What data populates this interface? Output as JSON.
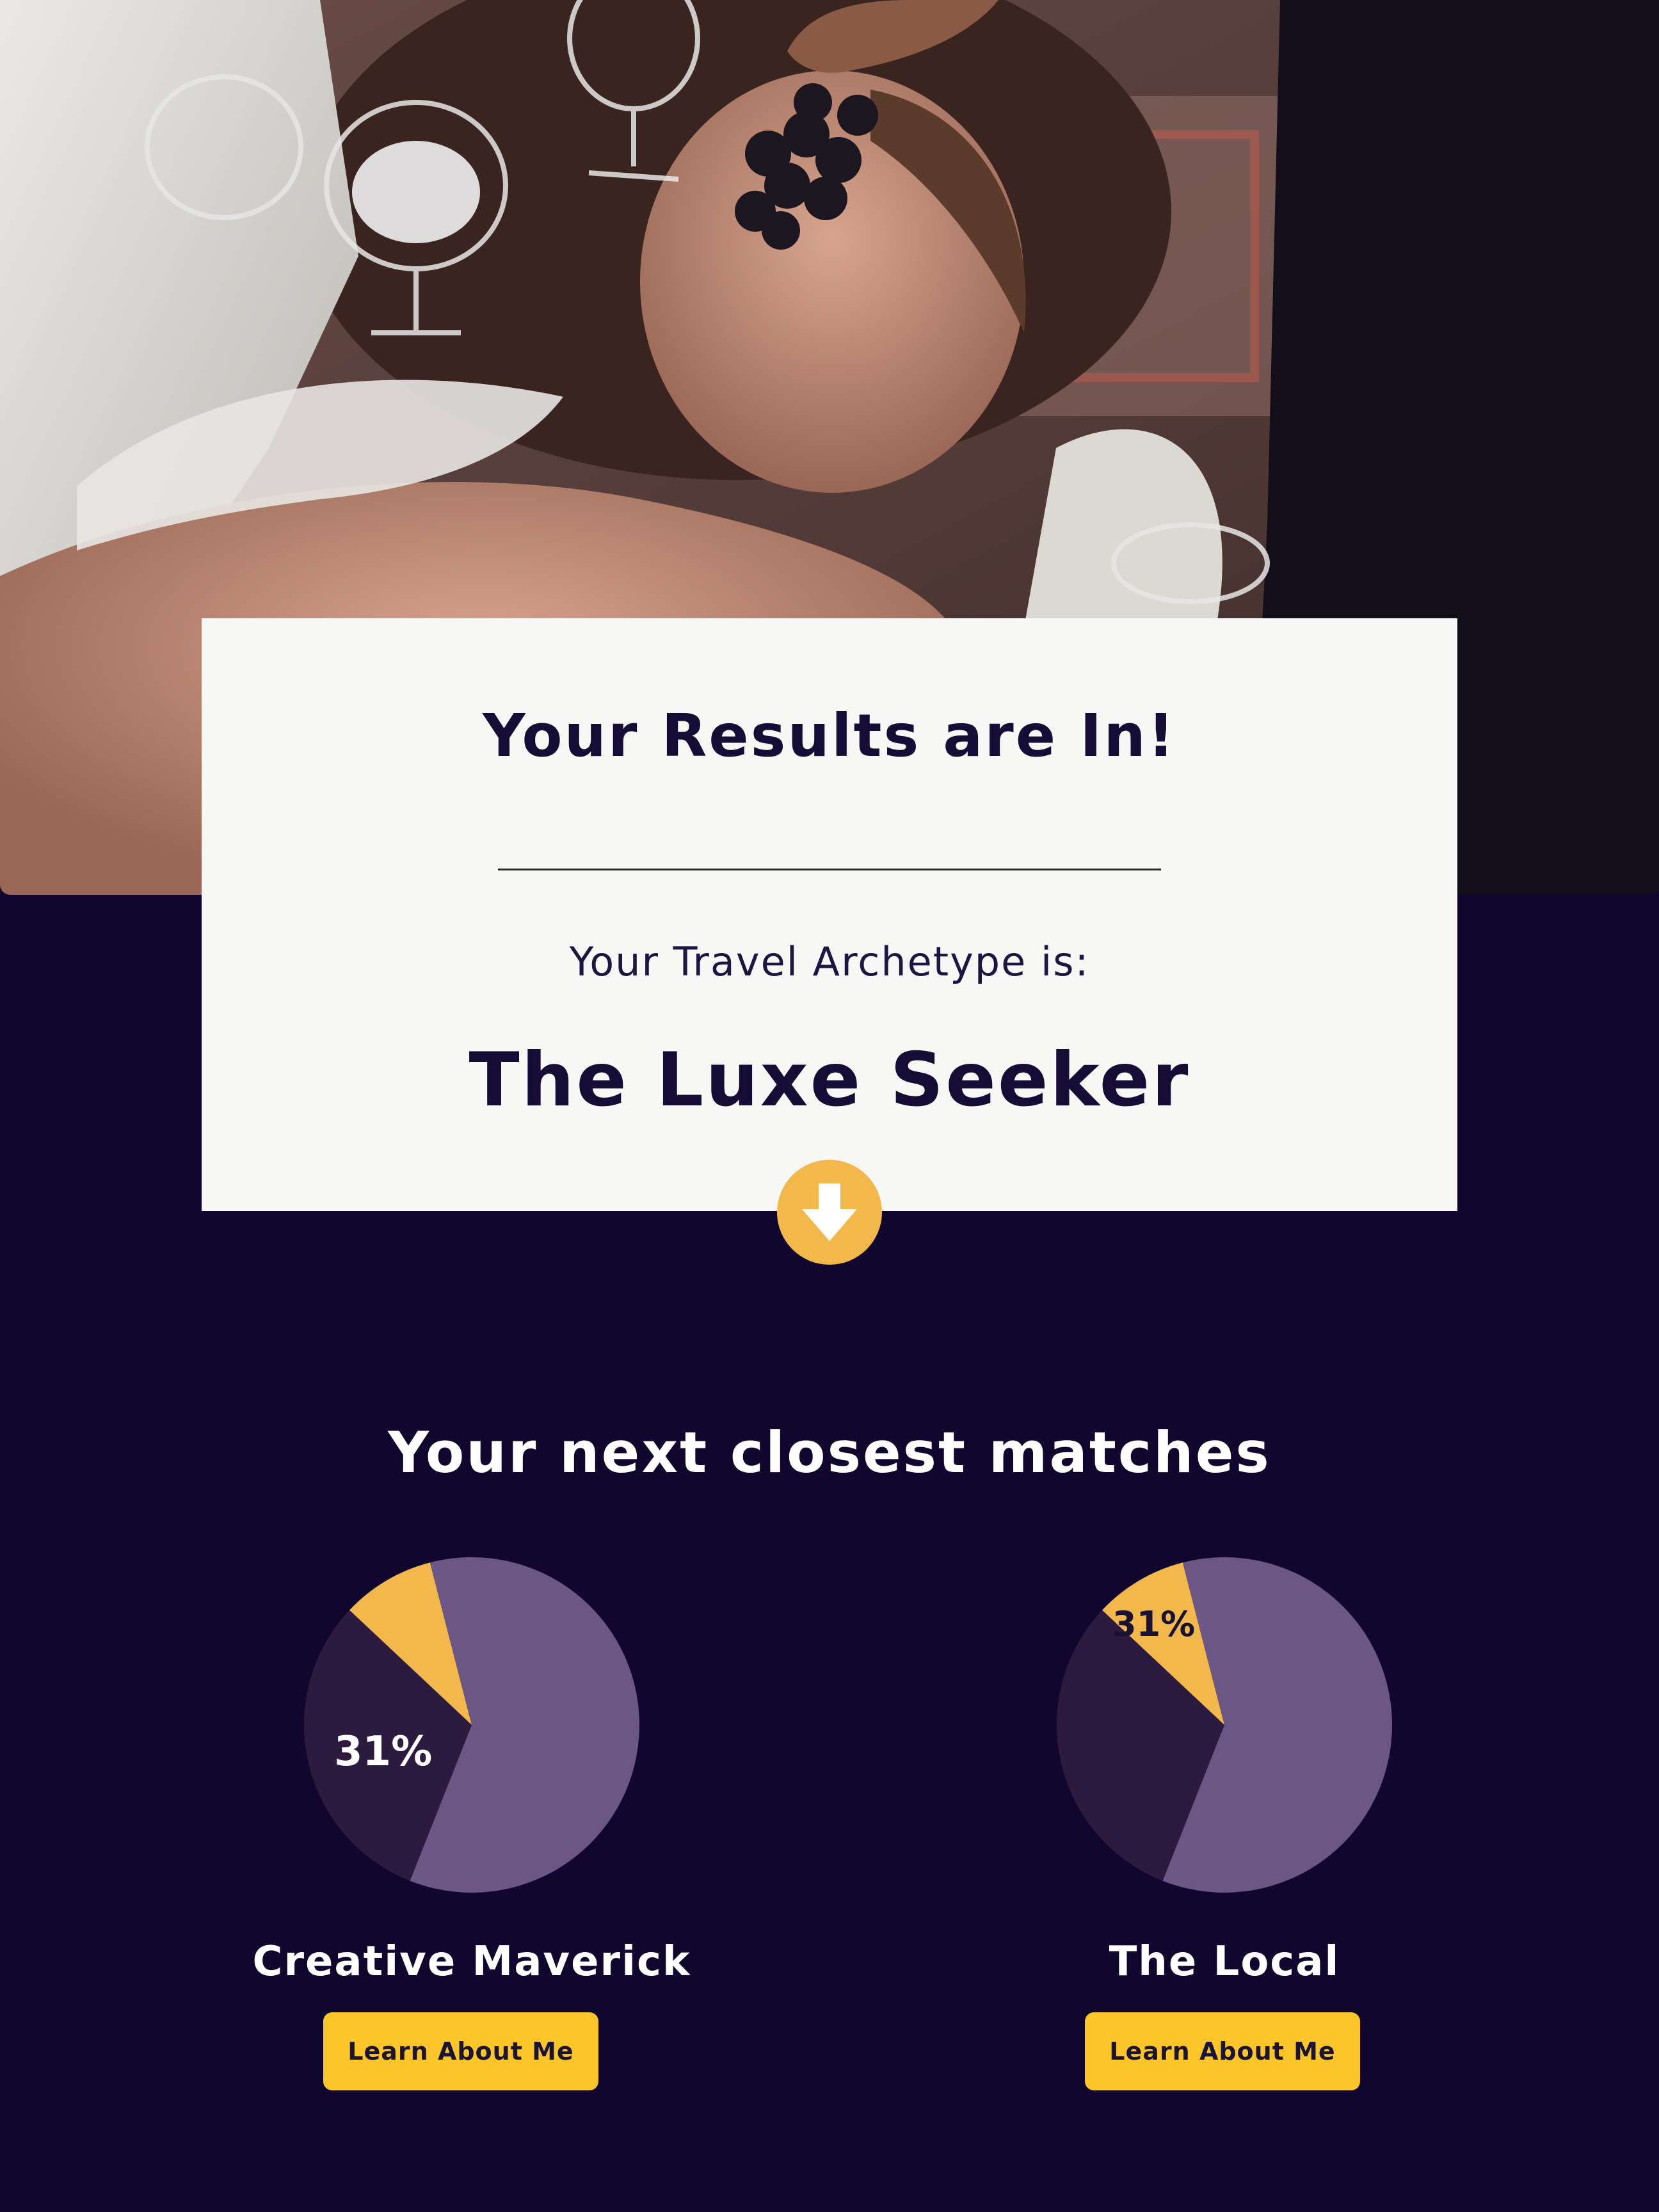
{
  "hero": {
    "image": "portrait-photo-grapes"
  },
  "result": {
    "title": "Your Results are In!",
    "archetype_label": "Your Travel Archetype is:",
    "archetype_name": "The Luxe Seeker",
    "scroll_icon": "arrow-down-icon"
  },
  "matches": {
    "title": "Your next closest matches",
    "items": [
      {
        "name": "Creative Maverick",
        "percent_label": "31%",
        "button_label": "Learn About Me"
      },
      {
        "name": "The Local",
        "percent_label": "31%",
        "button_label": "Learn About Me"
      }
    ]
  },
  "colors": {
    "background": "#10062e",
    "card": "#f7f7f5",
    "accent_yellow": "#f2b84b",
    "button_yellow": "#fcc62b",
    "pie_light_purple": "#6c5686",
    "pie_dark_purple": "#2d1b3f",
    "pie_yellow": "#f2b84b",
    "text_dark": "#160d36"
  },
  "chart_data": [
    {
      "type": "pie",
      "name": "Creative Maverick",
      "slices": [
        {
          "value": 56,
          "color": "#6c5686"
        },
        {
          "value": 31,
          "color": "#2d1b3f"
        },
        {
          "value": 9,
          "color": "#f2b84b"
        },
        {
          "value": 4,
          "color": "#6c5686"
        }
      ],
      "labels": [
        "31%"
      ]
    },
    {
      "type": "pie",
      "name": "The Local",
      "slices": [
        {
          "value": 56,
          "color": "#6c5686"
        },
        {
          "value": 31,
          "color": "#2d1b3f"
        },
        {
          "value": 9,
          "color": "#f2b84b"
        },
        {
          "value": 4,
          "color": "#6c5686"
        }
      ],
      "labels": [
        "31%"
      ]
    }
  ]
}
